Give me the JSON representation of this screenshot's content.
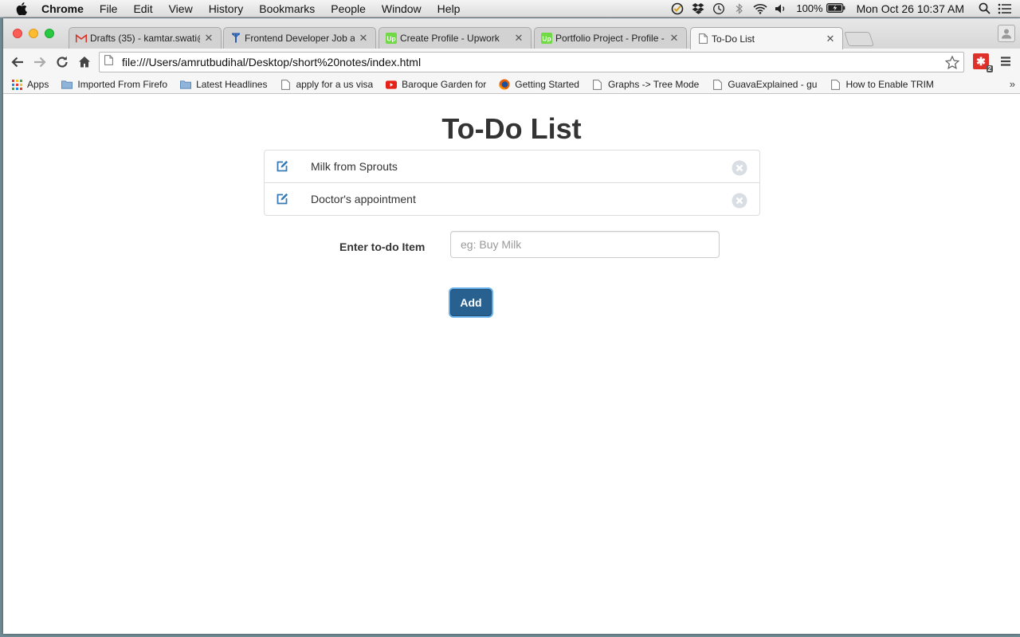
{
  "menubar": {
    "app_name": "Chrome",
    "items": [
      "File",
      "Edit",
      "View",
      "History",
      "Bookmarks",
      "People",
      "Window",
      "Help"
    ],
    "battery_percent": "100%",
    "clock": "Mon Oct 26  10:37 AM"
  },
  "tabs": [
    {
      "title": "Drafts (35) - kamtar.swati@",
      "favicon": "gmail-icon",
      "active": false
    },
    {
      "title": "Frontend Developer Job an",
      "favicon": "job-icon",
      "active": false
    },
    {
      "title": "Create Profile - Upwork",
      "favicon": "upwork-icon",
      "active": false
    },
    {
      "title": "Portfolio Project - Profile - ",
      "favicon": "upwork-icon",
      "active": false
    },
    {
      "title": "To-Do List",
      "favicon": "page-icon",
      "active": true
    }
  ],
  "toolbar": {
    "url": "file:///Users/amrutbudihal/Desktop/short%20notes/index.html",
    "extension_badge": "2"
  },
  "bookmarks": [
    {
      "label": "Apps",
      "icon": "apps-grid-icon"
    },
    {
      "label": "Imported From Firefo",
      "icon": "folder-icon"
    },
    {
      "label": "Latest Headlines",
      "icon": "folder-icon"
    },
    {
      "label": "apply for a us visa",
      "icon": "page-icon"
    },
    {
      "label": "Baroque Garden for",
      "icon": "youtube-icon"
    },
    {
      "label": "Getting Started",
      "icon": "firefox-icon"
    },
    {
      "label": "Graphs -> Tree Mode",
      "icon": "page-icon"
    },
    {
      "label": "GuavaExplained - gu",
      "icon": "page-icon"
    },
    {
      "label": "How to Enable TRIM",
      "icon": "page-icon"
    }
  ],
  "page": {
    "title": "To-Do List",
    "items": [
      {
        "text": "Milk from Sprouts"
      },
      {
        "text": "Doctor's appointment"
      }
    ],
    "form": {
      "label": "Enter to-do Item",
      "placeholder": "eg: Buy Milk",
      "value": "",
      "add_label": "Add"
    }
  },
  "colors": {
    "primary_button": "#286090",
    "edit_icon": "#337ab7",
    "remove_icon": "#d8dee3",
    "heading_text": "#333333"
  }
}
